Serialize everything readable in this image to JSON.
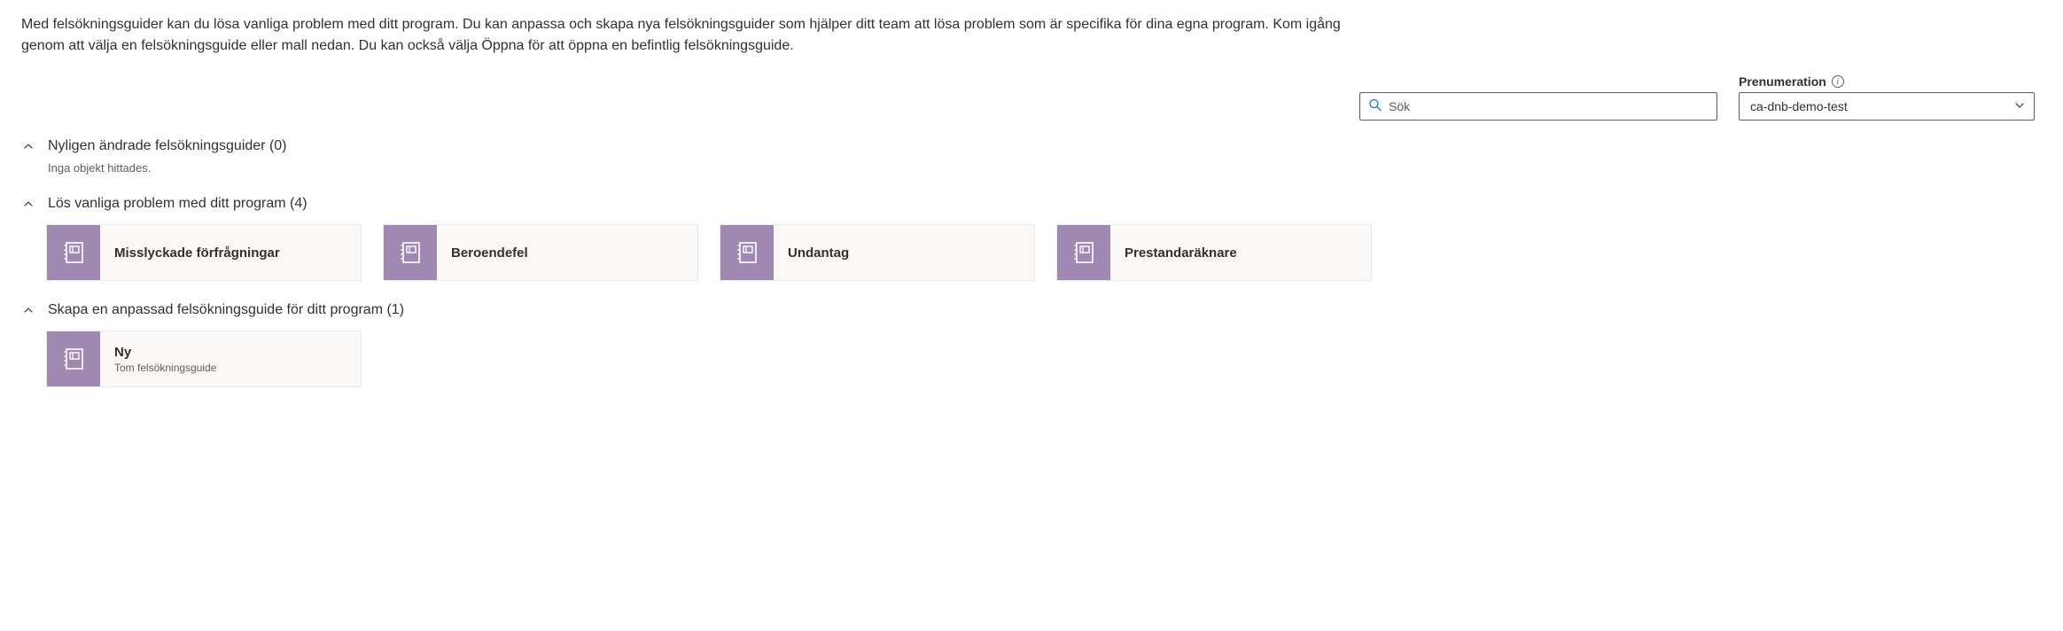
{
  "intro": "Med felsökningsguider kan du lösa vanliga problem med ditt program. Du kan anpassa och skapa nya felsökningsguider som hjälper ditt team att lösa problem som är specifika för dina egna program. Kom igång genom att välja en felsökningsguide eller mall nedan. Du kan också välja Öppna för att öppna en befintlig felsökningsguide.",
  "search": {
    "placeholder": "Sök"
  },
  "subscription": {
    "label": "Prenumeration",
    "value": "ca-dnb-demo-test"
  },
  "sections": {
    "recent": {
      "title": "Nyligen ändrade felsökningsguider (0)",
      "empty": "Inga objekt hittades."
    },
    "common": {
      "title": "Lös vanliga problem med ditt program (4)",
      "cards": [
        {
          "title": "Misslyckade förfrågningar"
        },
        {
          "title": "Beroendefel"
        },
        {
          "title": "Undantag"
        },
        {
          "title": "Prestandaräknare"
        }
      ]
    },
    "custom": {
      "title": "Skapa en anpassad felsökningsguide för ditt program (1)",
      "cards": [
        {
          "title": "Ny",
          "subtitle": "Tom felsökningsguide"
        }
      ]
    }
  }
}
